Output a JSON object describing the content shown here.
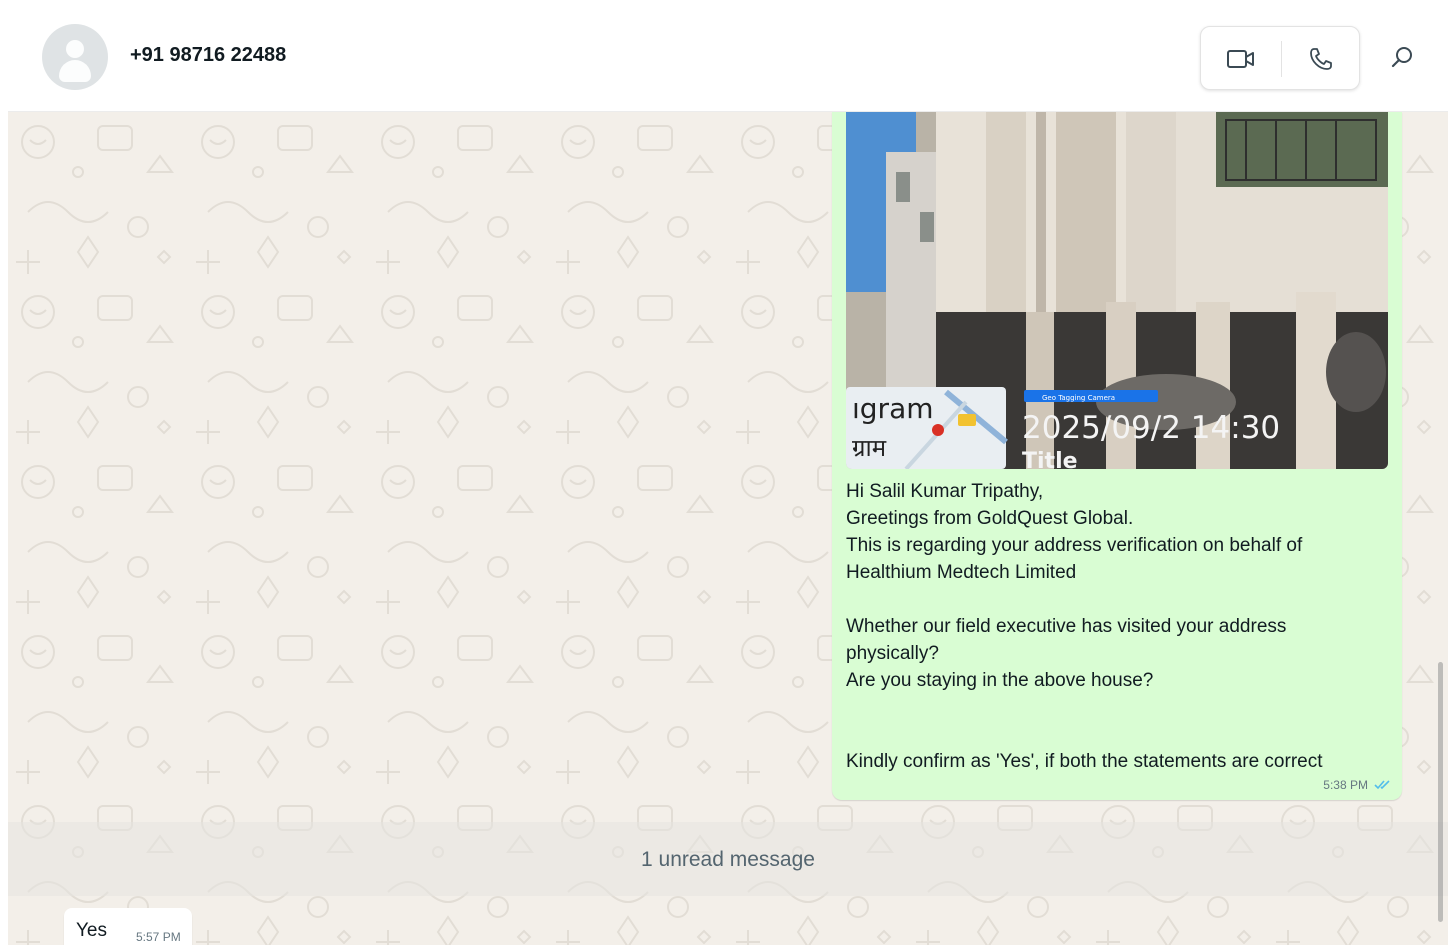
{
  "header": {
    "contact_name": "+91 98716 22488",
    "icons": [
      "avatar-placeholder",
      "video-call-icon",
      "voice-call-icon",
      "search-icon"
    ]
  },
  "messages": [
    {
      "direction": "outgoing",
      "image": {
        "overlay_place_latin": "ıgram",
        "overlay_place_devanagari": "ग्राम",
        "overlay_badge": "Geo Tagging Camera",
        "overlay_datetime": "2025/09/2 14:30",
        "overlay_title": "Title"
      },
      "lines": [
        "Hi Salil Kumar Tripathy,",
        "Greetings from GoldQuest Global.",
        "This is regarding your address verification on behalf of Healthium Medtech Limited",
        "",
        "Whether our field executive has visited your address physically?",
        "Are you staying in the above house?",
        "",
        "",
        "Kindly confirm as 'Yes', if both the statements are correct"
      ],
      "time": "5:38 PM",
      "status": "read"
    },
    {
      "direction": "incoming",
      "text": "Yes",
      "time": "5:57 PM"
    }
  ],
  "unread_divider": "1 unread message",
  "colors": {
    "outgoing_bubble": "#d9fdd3",
    "incoming_bubble": "#ffffff",
    "chat_background": "#f3efe9",
    "read_tick": "#53bdeb"
  }
}
